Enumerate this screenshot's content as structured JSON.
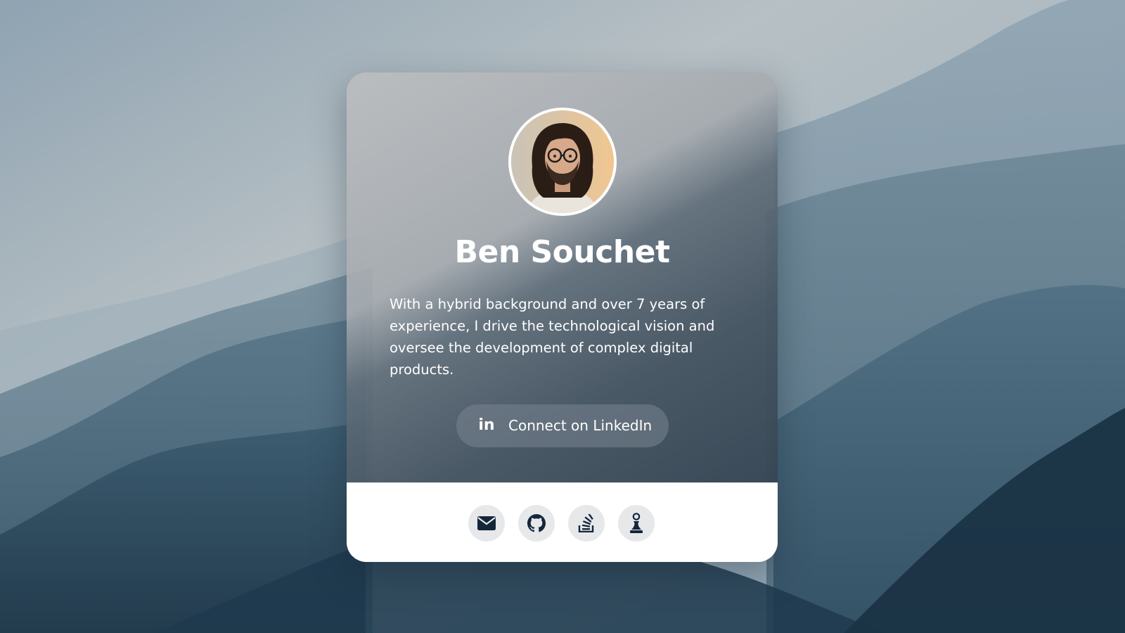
{
  "profile": {
    "name": "Ben Souchet",
    "bio": "With a hybrid background and over 7 years of experience, I drive the technological vision and oversee the development of complex digital products.",
    "avatar_icon": "profile-photo"
  },
  "linkedin": {
    "label": "Connect on LinkedIn",
    "icon": "linkedin-icon",
    "icon_text": "in"
  },
  "social_links": [
    {
      "icon": "mail-icon",
      "target": "email"
    },
    {
      "icon": "github-icon",
      "target": "github"
    },
    {
      "icon": "stackoverflow-icon",
      "target": "stackoverflow"
    },
    {
      "icon": "chess-pawn-icon",
      "target": "chess"
    }
  ],
  "colors": {
    "card_top": "#5f7282",
    "card_bottom": "#ffffff",
    "icon_bg": "#e7e8ea",
    "icon_fg": "#14263a",
    "text": "#ffffff"
  }
}
